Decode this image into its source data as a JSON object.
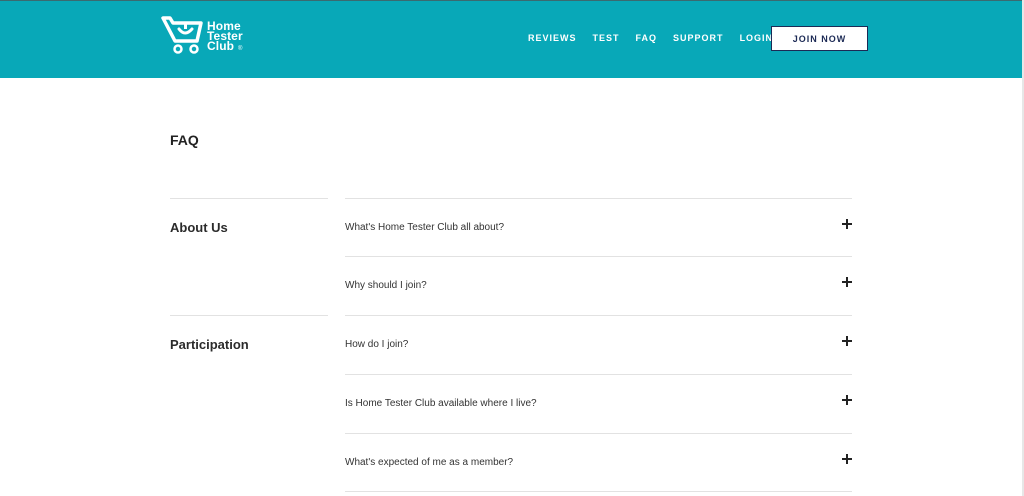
{
  "header": {
    "logo": {
      "line1": "Home",
      "line2": "Tester",
      "line3": "Club",
      "reg": "®",
      "icon": "shopping-cart-icon"
    },
    "nav": [
      {
        "label": "REVIEWS"
      },
      {
        "label": "TEST"
      },
      {
        "label": "FAQ"
      },
      {
        "label": "SUPPORT"
      },
      {
        "label": "LOGIN"
      }
    ],
    "join_label": "JOIN NOW",
    "colors": {
      "background": "#08a8b8",
      "button_text": "#1c2a55"
    }
  },
  "page": {
    "title": "FAQ"
  },
  "categories": [
    {
      "label": "About Us"
    },
    {
      "label": "Participation"
    }
  ],
  "questions": [
    {
      "text": "What's Home Tester Club all about?"
    },
    {
      "text": "Why should I join?"
    },
    {
      "text": "How do I join?"
    },
    {
      "text": "Is Home Tester Club available where I live?"
    },
    {
      "text": "What's expected of me as a member?"
    }
  ]
}
